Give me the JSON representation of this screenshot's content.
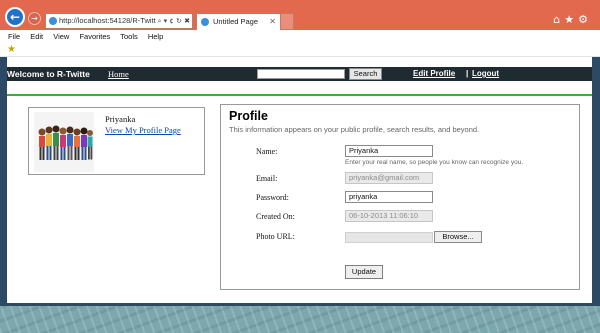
{
  "browser": {
    "url": "http://localhost:54128/R-Twitt",
    "address_icons": "⌕ ▾ ¢ ↻ ✖",
    "tab_title": "Untitled Page",
    "tab_close": "✕",
    "right_icons": "⌂★⚙",
    "back_glyph": "←",
    "forward_glyph": "→",
    "menu": [
      "File",
      "Edit",
      "View",
      "Favorites",
      "Tools",
      "Help"
    ],
    "favorites_glyph": "★"
  },
  "site_header": {
    "welcome": "Welcome to R-Twitte",
    "home_link": "Home",
    "search_button": "Search",
    "edit_profile_link": "Edit Profile",
    "separator": "|",
    "logout_link": "Logout"
  },
  "user_card": {
    "name": "Priyanka",
    "profile_link": "View My Profile Page"
  },
  "profile": {
    "title": "Profile",
    "description": "This information appears on your public profile, search results, and beyond.",
    "name_label": "Name:",
    "name_value": "Priyanka",
    "name_hint": "Enter your real name, so people you know can recognize you.",
    "email_label": "Email:",
    "email_value": "priyanka@gmail.com",
    "password_label": "Password:",
    "password_value": "priyanka",
    "created_label": "Created On:",
    "created_value": "06-10-2013 11:06:10",
    "photo_label": "Photo URL:",
    "browse_button": "Browse...",
    "update_button": "Update"
  },
  "colors": {
    "chrome_bg": "#e2694e",
    "page_frame": "#2d4a64",
    "header_bar": "#202a31",
    "divider": "#3cab3c",
    "link": "#0b46b8"
  }
}
